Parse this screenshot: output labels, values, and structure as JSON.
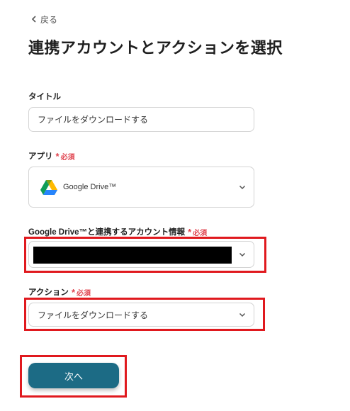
{
  "nav": {
    "back_label": "戻る"
  },
  "page": {
    "title": "連携アカウントとアクションを選択"
  },
  "required_label": "必須",
  "fields": {
    "title": {
      "label": "タイトル",
      "value": "ファイルをダウンロードする"
    },
    "app": {
      "label": "アプリ",
      "value": "Google Drive™",
      "icon": "google-drive-icon"
    },
    "account": {
      "label": "Google Drive™と連携するアカウント情報"
    },
    "action": {
      "label": "アクション",
      "value": "ファイルをダウンロードする"
    }
  },
  "buttons": {
    "next_label": "次へ"
  },
  "colors": {
    "accent": "#1c6b85",
    "required": "#e0444f",
    "highlight": "#e0191e"
  }
}
